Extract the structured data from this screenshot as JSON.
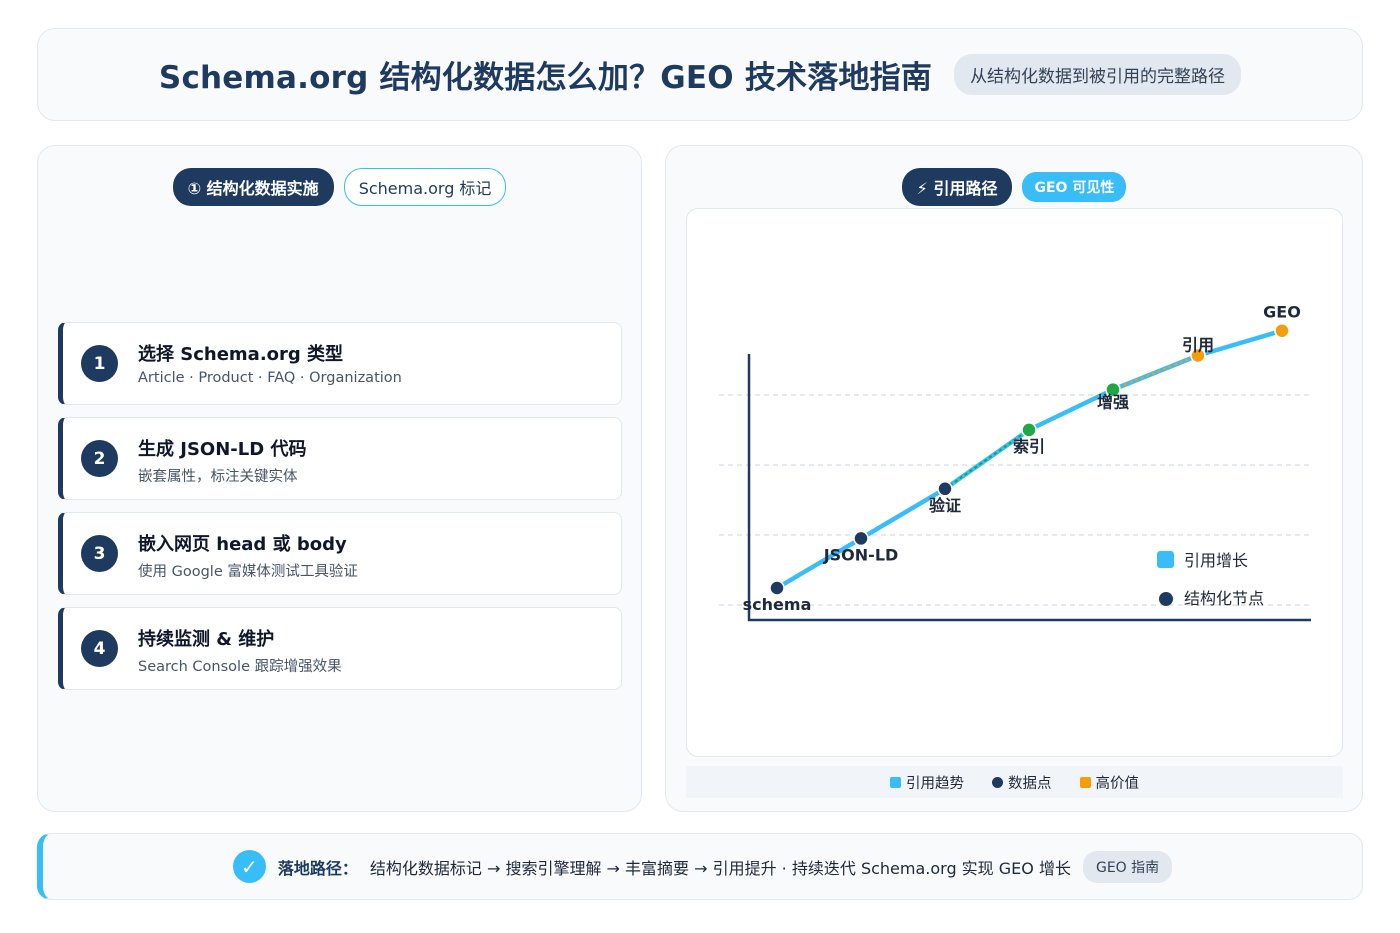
{
  "header": {
    "title": "Schema.org 结构化数据怎么加？GEO 技术落地指南",
    "subtitle": "从结构化数据到被引用的完整路径"
  },
  "left_panel": {
    "tab_active": "① 结构化数据实施",
    "tab_secondary": "Schema.org 标记",
    "steps": [
      {
        "num": "1",
        "title": "选择 Schema.org 类型",
        "desc": "Article · Product · FAQ · Organization"
      },
      {
        "num": "2",
        "title": "生成 JSON-LD 代码",
        "desc": "嵌套属性，标注关键实体"
      },
      {
        "num": "3",
        "title": "嵌入网页 head 或 body",
        "desc": "使用 Google 富媒体测试工具验证"
      },
      {
        "num": "4",
        "title": "持续监测 & 维护",
        "desc": "Search Console 跟踪增强效果"
      }
    ]
  },
  "right_panel": {
    "tab_active": "⚡ 引用路径",
    "tab_secondary": "GEO 可见性",
    "bottom_legend": {
      "trend": "引用趋势",
      "points": "数据点",
      "high_value": "高价值"
    }
  },
  "chart_data": {
    "type": "line",
    "x": [
      "schema",
      "JSON-LD",
      "验证",
      "索引",
      "增强",
      "引用",
      "GEO"
    ],
    "series": [
      {
        "name": "引用增长",
        "values": [
          1,
          2.6,
          4.2,
          6.1,
          7.4,
          8.5,
          9.3
        ]
      }
    ],
    "point_kinds": [
      "structural",
      "structural",
      "structural",
      "milestone",
      "milestone",
      "high-value",
      "high-value"
    ],
    "legend": [
      "引用增长",
      "结构化节点"
    ],
    "legend_placement": "bottom-right",
    "grid": true,
    "ylim": [
      0,
      10
    ],
    "colors": {
      "line": "#38bdf8",
      "structural": "#1e3a5f",
      "milestone": "#22a745",
      "high_value": "#f59e0b",
      "axis": "#1e3a5f"
    }
  },
  "footer": {
    "label": "落地路径：",
    "text": "结构化数据标记 → 搜索引擎理解 → 丰富摘要 → 引用提升 · 持续迭代 Schema.org 实现 GEO 增长",
    "pill": "GEO 指南"
  }
}
